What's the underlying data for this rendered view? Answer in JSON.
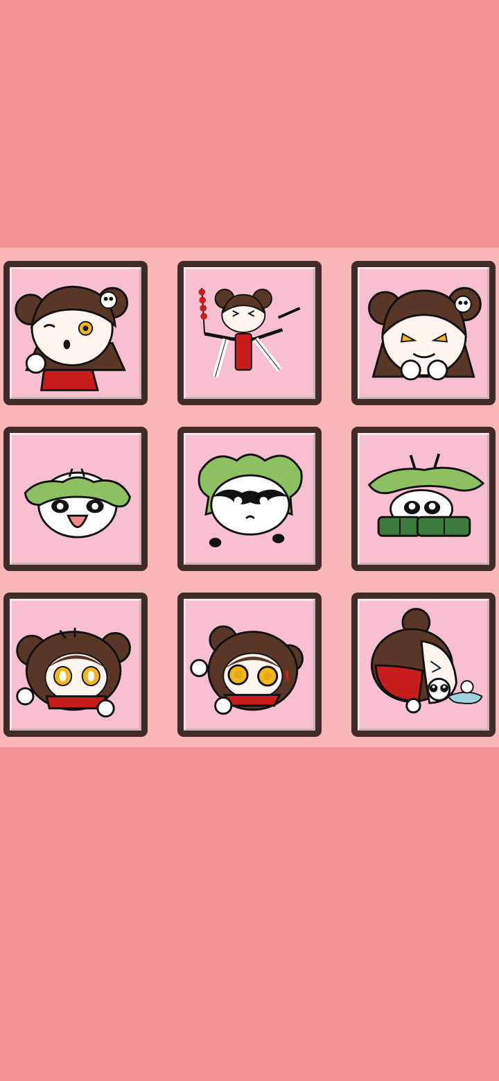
{
  "page": {
    "background_color": "#f19393",
    "grid_background_color": "#f8b6b6",
    "tile_frame_color": "#3f2b29",
    "tile_fill_color": "#f7bfd0"
  },
  "stickers": [
    {
      "icon": "girl-winking-thumbs-up-sticker"
    },
    {
      "icon": "girl-dancing-with-candied-haws-sticker"
    },
    {
      "icon": "girl-smug-grin-sticker"
    },
    {
      "icon": "panda-leaf-hat-laughing-sticker"
    },
    {
      "icon": "panda-leaf-hat-surprised-sticker"
    },
    {
      "icon": "panda-leaf-hat-hiding-behind-bamboo-sticker"
    },
    {
      "icon": "girl-peeking-over-edge-sticker"
    },
    {
      "icon": "girl-nervous-peeking-sticker"
    },
    {
      "icon": "girl-lying-face-down-with-panda-sticker"
    }
  ]
}
